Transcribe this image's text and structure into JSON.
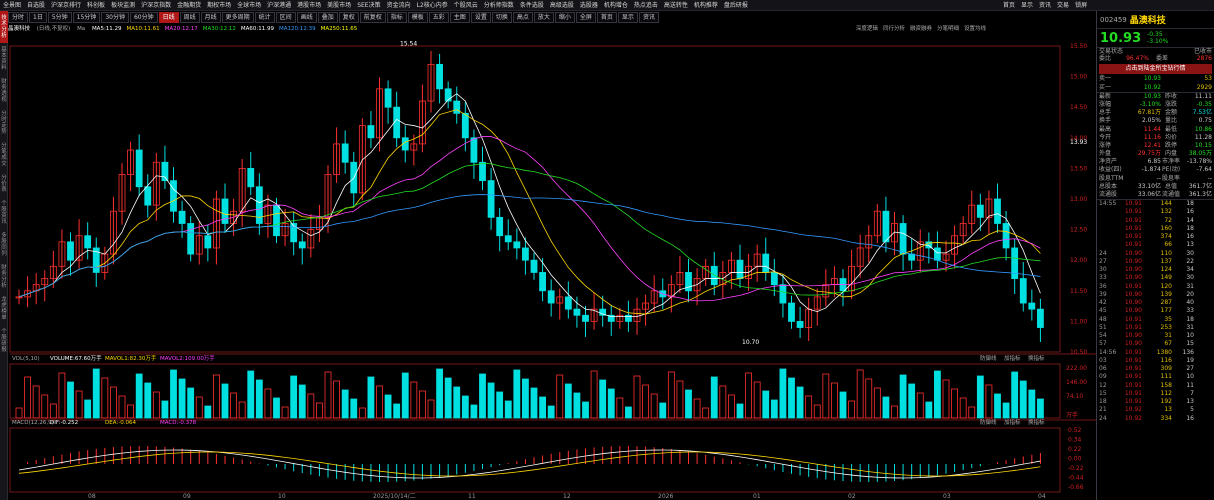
{
  "menubar": [
    "全景图",
    "自选股",
    "沪深京排行",
    "科创板",
    "板块监测",
    "沪深京指数",
    "金融期货",
    "期权市场",
    "全球市场",
    "沪深港通",
    "港股市场",
    "美股市场",
    "SEE决策",
    "资金流向",
    "L2核心内参",
    "个股风云",
    "分析师指数",
    "条件选股",
    "高级选股",
    "选股器",
    "机构增仓",
    "热点追击",
    "高送转性",
    "机构推荐",
    "盘后研报"
  ],
  "right_top": [
    "首页",
    "显示",
    "资讯",
    "交易",
    "锁屏"
  ],
  "toolbar": [
    "分时",
    "1日",
    "5分钟",
    "15分钟",
    "30分钟",
    "60分钟",
    "日线",
    "周线",
    "月线",
    "更多周期",
    "统计",
    "区间",
    "画线",
    "叠加",
    "复权",
    "前复权",
    "指标",
    "模板",
    "五彩",
    "主图",
    "设置",
    "切换",
    "高点",
    "放大",
    "缩小",
    "全屏",
    "首页",
    "显示",
    "资讯"
  ],
  "toolbar_active": "日线",
  "leftnav": [
    "技术分析",
    "基本资料",
    "财务透视",
    "分时走势",
    "分笔成交",
    "分价表",
    "个股资讯",
    "多股同列",
    "财务分析",
    "龙虎榜单",
    "个股研报"
  ],
  "infobar": {
    "title": "晶澳科技",
    "fuquan": "(日线,不复权)",
    "ma": "Ma",
    "items": [
      {
        "t": "MA5:11.29",
        "c": "#ffffff"
      },
      {
        "t": "MA10:11.61",
        "c": "#ffd700"
      },
      {
        "t": "MA20:12.17",
        "c": "#ff40ff"
      },
      {
        "t": "MA30:12.12",
        "c": "#22dd22"
      },
      {
        "t": "MA60:11.99",
        "c": "#ffffff"
      },
      {
        "t": "MA120:12.39",
        "c": "#3399ff"
      },
      {
        "t": "MA250:11.65",
        "c": "#ffff00"
      }
    ],
    "tabs": [
      "深度逻辑",
      "同行分析",
      "融资融券",
      "分笔明细",
      "设置均线"
    ]
  },
  "price_axis": [
    "15.50",
    "15.00",
    "14.50",
    "14.00",
    "13.93",
    "13.50",
    "13.00",
    "12.50",
    "12.00",
    "11.50",
    "11.00",
    "10.50"
  ],
  "vol_axis": [
    "222.00",
    "146.00",
    "74.10",
    "万手"
  ],
  "macd_axis": [
    "0.52",
    "0.34",
    "0.22",
    "0.00",
    "-0.22",
    "-0.44",
    "-0.66"
  ],
  "annotations": {
    "high": "15.54",
    "low": "10.70"
  },
  "vol_info": {
    "label": "VOL(5,10)",
    "items": [
      {
        "t": "VOLUME:67.60万手",
        "c": "#ffffff"
      },
      {
        "t": "MAVOL1:82.30万手",
        "c": "#ffd700"
      },
      {
        "t": "MAVOL2:109.00万手",
        "c": "#ff40ff"
      }
    ],
    "tabs": [
      "防御线",
      "加指标",
      "换指标"
    ]
  },
  "macd_info": {
    "label": "MACD(12,26,9)",
    "items": [
      {
        "t": "DIF:-0.252",
        "c": "#ffffff"
      },
      {
        "t": "DEA:-0.064",
        "c": "#ffd700"
      },
      {
        "t": "MACD:-0.378",
        "c": "#ff40ff"
      }
    ],
    "tabs": [
      "防御线",
      "加指标",
      "换指标"
    ]
  },
  "date_axis": [
    "08",
    "09",
    "10",
    "2025/10/14/二",
    "11",
    "12",
    "2026",
    "01",
    "02",
    "03",
    "04"
  ],
  "stock": {
    "code": "002459",
    "name": "晶澳科技",
    "price": "10.93",
    "change": "-0.35",
    "pct": "-3.10%"
  },
  "panel_header": {
    "left": "交易状态",
    "right": "已收市"
  },
  "weibi": {
    "l1": "委比",
    "v1": "96.47%",
    "l2": "委差",
    "v2": "2876"
  },
  "link": "点击到陆金所宝钻行情",
  "asks": [
    {
      "l": "卖一",
      "p": "10.93",
      "v": "53"
    }
  ],
  "bids": [
    {
      "l": "买一",
      "p": "10.92",
      "v": "2929"
    }
  ],
  "quote": [
    {
      "a": "最新",
      "b": "10.93",
      "bc": "dn",
      "c": "昨收",
      "d": "11.11",
      "dc": ""
    },
    {
      "a": "涨幅",
      "b": "-3.10%",
      "bc": "dn",
      "c": "涨跌",
      "d": "-0.35",
      "dc": "dn"
    },
    {
      "a": "总手",
      "b": "67.81万",
      "bc": "yl",
      "c": "金额",
      "d": "7.53亿",
      "dc": "cy"
    },
    {
      "a": "换手",
      "b": "2.05%",
      "bc": "",
      "c": "量比",
      "d": "0.75",
      "dc": ""
    },
    {
      "a": "最高",
      "b": "11.44",
      "bc": "up",
      "c": "最低",
      "d": "10.86",
      "dc": "dn"
    },
    {
      "a": "今开",
      "b": "11.16",
      "bc": "up",
      "c": "均价",
      "d": "11.28",
      "dc": ""
    },
    {
      "a": "涨停",
      "b": "12.41",
      "bc": "up",
      "c": "跌停",
      "d": "10.15",
      "dc": "dn"
    },
    {
      "a": "外盘",
      "b": "29.75万",
      "bc": "up",
      "c": "内盘",
      "d": "38.05万",
      "dc": "dn"
    },
    {
      "a": "净资产",
      "b": "6.85",
      "bc": "",
      "c": "市净率",
      "d": "-13.78%",
      "dc": ""
    },
    {
      "a": "收益(四)",
      "b": "-1.874",
      "bc": "",
      "c": "PE(动)",
      "d": "-7.64",
      "dc": ""
    },
    {
      "a": "股息TTM",
      "b": "--",
      "bc": "",
      "c": "股息率",
      "d": "--",
      "dc": ""
    },
    {
      "a": "总股本",
      "b": "33.10亿",
      "bc": "",
      "c": "总值",
      "d": "361.7亿",
      "dc": ""
    },
    {
      "a": "流通股",
      "b": "33.06亿",
      "bc": "",
      "c": "流通值",
      "d": "361.3亿",
      "dc": ""
    }
  ],
  "ticks": [
    {
      "t": "14:55",
      "p": "10.91",
      "v": "144",
      "n": "18"
    },
    {
      "t": "",
      "p": "10.91",
      "v": "132",
      "n": "16"
    },
    {
      "t": "",
      "p": "10.91",
      "v": "72",
      "n": "14"
    },
    {
      "t": "",
      "p": "10.91",
      "v": "160",
      "n": "18"
    },
    {
      "t": "",
      "p": "10.91",
      "v": "374",
      "n": "16"
    },
    {
      "t": "",
      "p": "10.91",
      "v": "66",
      "n": "13"
    },
    {
      "t": "24",
      "p": "10.90",
      "v": "110",
      "n": "30"
    },
    {
      "t": "27",
      "p": "10.90",
      "v": "137",
      "n": "22"
    },
    {
      "t": "30",
      "p": "10.90",
      "v": "124",
      "n": "34"
    },
    {
      "t": "33",
      "p": "10.90",
      "v": "149",
      "n": "30"
    },
    {
      "t": "36",
      "p": "10.91",
      "v": "120",
      "n": "31"
    },
    {
      "t": "39",
      "p": "10.90",
      "v": "139",
      "n": "20"
    },
    {
      "t": "42",
      "p": "10.90",
      "v": "287",
      "n": "40"
    },
    {
      "t": "45",
      "p": "10.90",
      "v": "177",
      "n": "33"
    },
    {
      "t": "48",
      "p": "10.91",
      "v": "35",
      "n": "18"
    },
    {
      "t": "51",
      "p": "10.91",
      "v": "253",
      "n": "31"
    },
    {
      "t": "54",
      "p": "10.90",
      "v": "31",
      "n": "10"
    },
    {
      "t": "57",
      "p": "10.90",
      "v": "67",
      "n": "15"
    },
    {
      "t": "14:56",
      "p": "10.91",
      "v": "1380",
      "n": "136"
    },
    {
      "t": "03",
      "p": "10.91",
      "v": "116",
      "n": "19"
    },
    {
      "t": "06",
      "p": "10.91",
      "v": "309",
      "n": "27"
    },
    {
      "t": "09",
      "p": "10.91",
      "v": "111",
      "n": "10"
    },
    {
      "t": "12",
      "p": "10.91",
      "v": "158",
      "n": "11"
    },
    {
      "t": "15",
      "p": "10.91",
      "v": "112",
      "n": "7"
    },
    {
      "t": "18",
      "p": "10.91",
      "v": "192",
      "n": "13"
    },
    {
      "t": "21",
      "p": "10.92",
      "v": "13",
      "n": "5"
    },
    {
      "t": "24",
      "p": "10.92",
      "v": "334",
      "n": "16"
    }
  ],
  "colors": {
    "up": "#ff3030",
    "down": "#00e0e0",
    "ma5": "#ffffff",
    "ma10": "#ffd700",
    "ma20": "#ff40ff",
    "ma30": "#22dd22",
    "ma60": "#ffffff",
    "ma120": "#3399ff",
    "ma250": "#ffff00",
    "active": "#b01818"
  },
  "chart_data": {
    "type": "candlestick",
    "ylim": [
      10.5,
      15.5
    ],
    "ohlc_trend": [
      11.4,
      11.5,
      11.6,
      11.7,
      11.9,
      12.3,
      12.0,
      12.4,
      12.2,
      11.8,
      12.1,
      12.8,
      13.4,
      13.8,
      13.2,
      12.9,
      13.6,
      13.3,
      12.8,
      12.6,
      12.1,
      12.4,
      12.2,
      13.0,
      12.6,
      12.8,
      13.5,
      13.2,
      12.6,
      12.9,
      12.4,
      12.6,
      12.3,
      12.2,
      12.5,
      12.7,
      13.4,
      13.9,
      13.6,
      13.1,
      14.2,
      14.0,
      14.8,
      14.5,
      14.0,
      13.8,
      13.9,
      14.6,
      15.2,
      14.8,
      14.6,
      14.4,
      14.0,
      13.6,
      13.3,
      12.7,
      12.4,
      12.3,
      12.2,
      12.0,
      11.8,
      11.5,
      11.3,
      11.4,
      11.2,
      11.1,
      11.0,
      11.2,
      11.1,
      11.0,
      11.1,
      11.0,
      11.2,
      11.3,
      11.5,
      11.4,
      11.6,
      11.8,
      11.5,
      11.7,
      11.9,
      11.6,
      11.8,
      12.0,
      11.7,
      11.9,
      12.1,
      11.8,
      11.6,
      11.3,
      11.0,
      10.9,
      11.2,
      11.4,
      11.6,
      11.7,
      11.5,
      11.9,
      12.2,
      12.4,
      12.8,
      12.3,
      12.6,
      12.1,
      12.0,
      12.3,
      12.2,
      12.0,
      12.1,
      12.4,
      12.6,
      12.9,
      12.7,
      13.0,
      12.6,
      12.2,
      11.7,
      11.3,
      11.2,
      10.9
    ]
  }
}
